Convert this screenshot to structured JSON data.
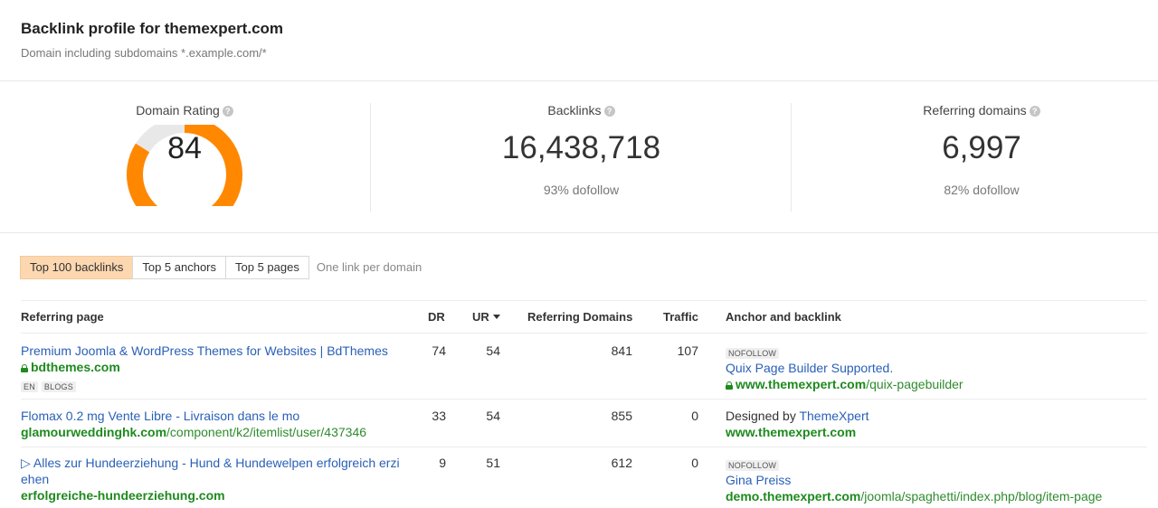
{
  "header": {
    "title": "Backlink profile for themexpert.com",
    "subtitle": "Domain including subdomains *.example.com/*"
  },
  "metrics": {
    "domain_rating": {
      "label": "Domain Rating",
      "value": "84",
      "fill_fraction": 0.84,
      "color": "#ff8800"
    },
    "backlinks": {
      "label": "Backlinks",
      "value": "16,438,718",
      "sub": "93% dofollow"
    },
    "referring_domains": {
      "label": "Referring domains",
      "value": "6,997",
      "sub": "82% dofollow"
    }
  },
  "tabs": {
    "items": [
      "Top 100 backlinks",
      "Top 5 anchors",
      "Top 5 pages"
    ],
    "active": 0,
    "option": "One link per domain"
  },
  "table": {
    "columns": [
      "Referring page",
      "DR",
      "UR",
      "Referring Domains",
      "Traffic",
      "Anchor and backlink"
    ],
    "rows": [
      {
        "title": "Premium Joomla & WordPress Themes for Websites | BdThemes",
        "domain": "bdthemes.com",
        "path": "",
        "tags": [
          "EN",
          "BLOGS"
        ],
        "dr": "74",
        "ur": "54",
        "ref_domains": "841",
        "traffic": "107",
        "anchor_badge": "NOFOLLOW",
        "anchor_text": "Quix Page Builder Supported.",
        "backlink_domain": "www.themexpert.com",
        "backlink_path": "/quix-pagebuilder"
      },
      {
        "title": "Flomax 0.2 mg Vente Libre - Livraison dans le mo",
        "domain": "glamourweddinghk.com",
        "path": "/component/k2/itemlist/user/437346",
        "dr": "33",
        "ur": "54",
        "ref_domains": "855",
        "traffic": "0",
        "anchor_prefix": "Designed by ",
        "anchor_text": "ThemeXpert",
        "backlink_domain": "www.themexpert.com",
        "backlink_path": ""
      },
      {
        "title_line1": "▷ Alles zur Hundeerziehung - Hund & Hundewelpen erfolgreich erzi",
        "title_line2": "ehen",
        "domain": "erfolgreiche-hundeerziehung.com",
        "path": "",
        "dr": "9",
        "ur": "51",
        "ref_domains": "612",
        "traffic": "0",
        "anchor_badge": "NOFOLLOW",
        "anchor_text": "Gina Preiss",
        "backlink_domain": "demo.themexpert.com",
        "backlink_path": "/joomla/spaghetti/index.php/blog/item-page"
      }
    ]
  }
}
